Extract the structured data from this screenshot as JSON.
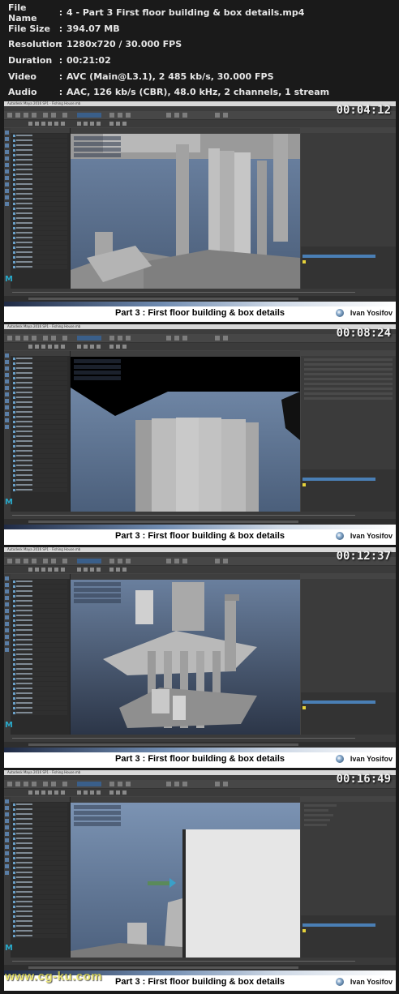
{
  "info": [
    {
      "key": "File Name",
      "value": "4 - Part 3 First floor building & box details.mp4"
    },
    {
      "key": "File Size",
      "value": "394.07 MB"
    },
    {
      "key": "Resolution",
      "value": "1280x720 / 30.000 FPS"
    },
    {
      "key": "Duration",
      "value": "00:21:02"
    },
    {
      "key": "Video",
      "value": "AVC (Main@L3.1), 2 485 kb/s, 30.000 FPS"
    },
    {
      "key": "Audio",
      "value": "AAC, 126 kb/s (CBR), 48.0 kHz, 2 channels, 1 stream"
    }
  ],
  "frames": [
    {
      "timecode": "00:04:12",
      "caption": "Part 3 : First floor building & box details",
      "author": "Ivan Yosifov",
      "window_title": "Autodesk Maya 2016 SP1 - Fishing House.mb"
    },
    {
      "timecode": "00:08:24",
      "caption": "Part 3 : First floor building & box details",
      "author": "Ivan Yosifov",
      "window_title": "Autodesk Maya 2016 SP1 - Fishing House.mb"
    },
    {
      "timecode": "00:12:37",
      "caption": "Part 3 : First floor building & box details",
      "author": "Ivan Yosifov",
      "window_title": "Autodesk Maya 2016 SP1 - Fishing House.mb"
    },
    {
      "timecode": "00:16:49",
      "caption": "Part 3 : First floor building & box details",
      "author": "Ivan Yosifov",
      "window_title": "Autodesk Maya 2016 SP1 - Fishing House.mb"
    }
  ],
  "watermark": "www.cg-ku.com",
  "colors": {
    "background": "#1a1a1a",
    "maya_accent": "#29a8c8",
    "selection_blue": "#4a7fb5",
    "watermark": "#e6e048"
  }
}
